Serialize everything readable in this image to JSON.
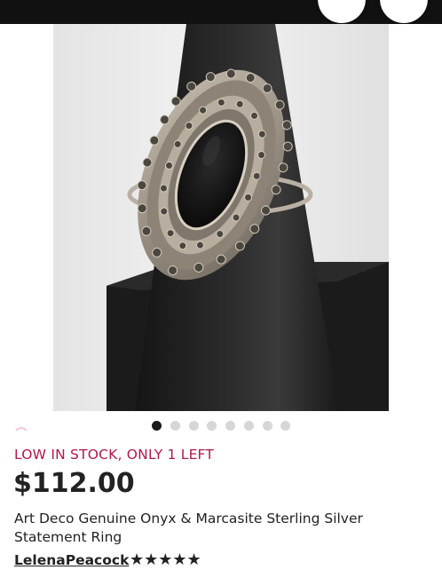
{
  "product": {
    "stock_status": "LOW IN STOCK, ONLY 1 LEFT",
    "price": "$112.00",
    "title": "Art Deco Genuine Onyx & Marcasite Sterling Silver Statement Ring",
    "seller": "LelenaPeacock",
    "rating_stars": 5,
    "stars_text": "★★★★★"
  },
  "gallery": {
    "image_count": 8,
    "active_index": 0
  },
  "colors": {
    "stock_accent": "#b0174c",
    "text": "#222222",
    "topbar": "#111111"
  },
  "icons": {
    "header_left_button": "round-button",
    "header_right_button": "round-button"
  }
}
